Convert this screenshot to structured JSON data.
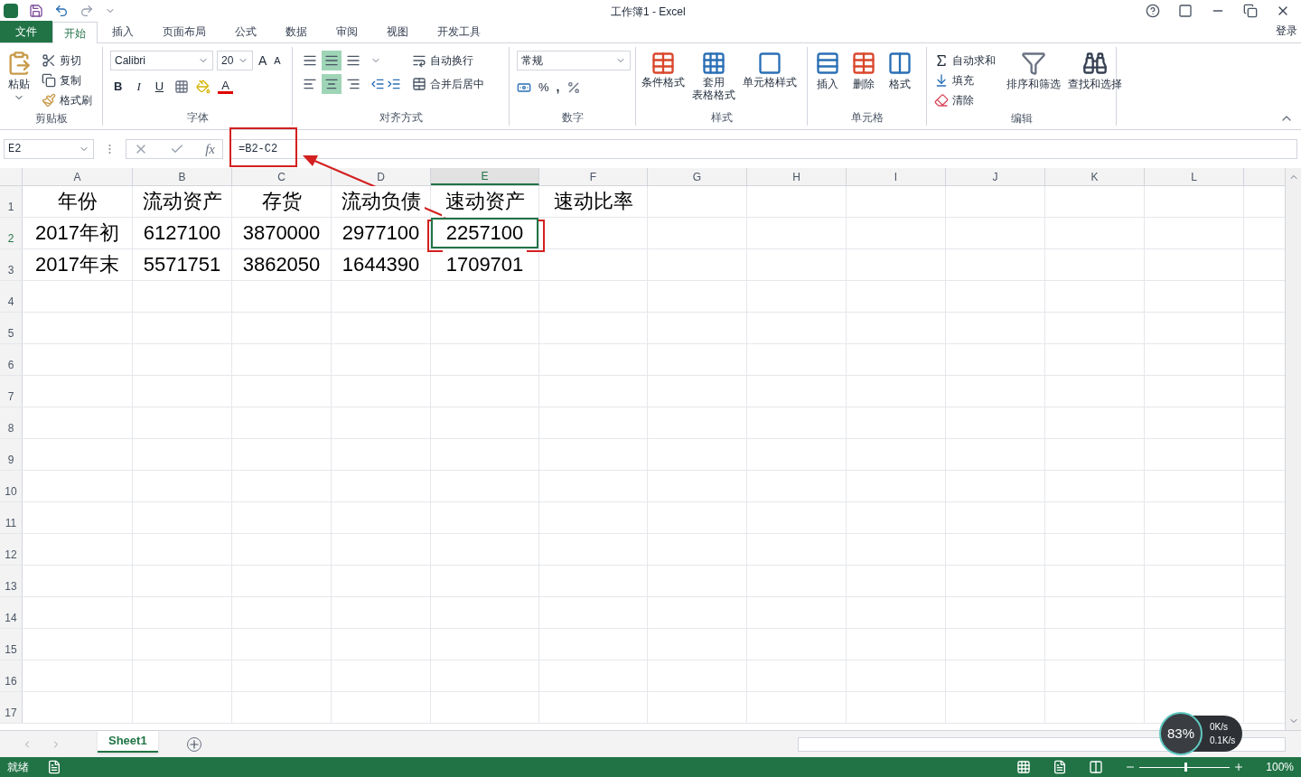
{
  "title_bar": {
    "title": "工作簿1 - Excel"
  },
  "ribbon_tabs": [
    {
      "label": "文件",
      "kind": "file",
      "selected": false
    },
    {
      "label": "开始",
      "kind": "tab",
      "selected": true
    },
    {
      "label": "插入",
      "kind": "tab",
      "selected": false
    },
    {
      "label": "页面布局",
      "kind": "tab",
      "selected": false
    },
    {
      "label": "公式",
      "kind": "tab",
      "selected": false
    },
    {
      "label": "数据",
      "kind": "tab",
      "selected": false
    },
    {
      "label": "审阅",
      "kind": "tab",
      "selected": false
    },
    {
      "label": "视图",
      "kind": "tab",
      "selected": false
    },
    {
      "label": "开发工具",
      "kind": "tab",
      "selected": false
    }
  ],
  "account": "登录",
  "clipboard": {
    "label": "剪贴板",
    "paste": "粘贴",
    "cut": "剪切",
    "copy": "复制",
    "format_painter": "格式刷"
  },
  "font": {
    "label": "字体",
    "font_name": "Calibri",
    "font_size": "20",
    "grow": "A",
    "shrink": "A",
    "bold": "B",
    "italic": "I",
    "underline": "U",
    "font_color": "A"
  },
  "alignment": {
    "label": "对齐方式",
    "vertical": [
      {
        "selected": false
      },
      {
        "selected": true
      },
      {
        "selected": false
      }
    ],
    "horizontal": [
      {
        "selected": false
      },
      {
        "selected": true
      },
      {
        "selected": false
      }
    ],
    "wrap": "自动换行",
    "merge": "合并后居中"
  },
  "number": {
    "label": "数字",
    "format": "常规",
    "percent": "%",
    "comma": ","
  },
  "styles": {
    "label": "样式",
    "buttons": [
      {
        "lines": [
          "条件格式"
        ],
        "kind": "conditional"
      },
      {
        "lines": [
          "套用",
          "表格格式"
        ],
        "kind": "table"
      },
      {
        "lines": [
          "单元格样式"
        ],
        "kind": "cellstyle"
      }
    ]
  },
  "cells_group": {
    "label": "单元格",
    "buttons": [
      {
        "label": "插入",
        "kind": "insert"
      },
      {
        "label": "删除",
        "kind": "delete"
      },
      {
        "label": "格式",
        "kind": "format"
      }
    ]
  },
  "editing": {
    "label": "编辑",
    "autosum": "自动求和",
    "fill": "填充",
    "clear": "清除",
    "sort": "排序和筛选",
    "find": "查找和选择"
  },
  "formula_bar": {
    "name_box": "E2",
    "function_label": "fx",
    "formula": "=B2-C2"
  },
  "columns": [
    {
      "label": "A",
      "selected": false
    },
    {
      "label": "B",
      "selected": false
    },
    {
      "label": "C",
      "selected": false
    },
    {
      "label": "D",
      "selected": false
    },
    {
      "label": "E",
      "selected": true
    },
    {
      "label": "F",
      "selected": false
    },
    {
      "label": "G",
      "selected": false
    },
    {
      "label": "H",
      "selected": false
    },
    {
      "label": "I",
      "selected": false
    },
    {
      "label": "J",
      "selected": false
    },
    {
      "label": "K",
      "selected": false
    },
    {
      "label": "L",
      "selected": false
    }
  ],
  "rows": [
    {
      "header": "1",
      "selected": false,
      "cells": [
        {
          "text": "年份",
          "selected": false
        },
        {
          "text": "流动资产",
          "selected": false
        },
        {
          "text": "存货",
          "selected": false
        },
        {
          "text": "流动负债",
          "selected": false
        },
        {
          "text": "速动资产",
          "selected": false
        },
        {
          "text": "速动比率",
          "selected": false
        }
      ]
    },
    {
      "header": "2",
      "selected": true,
      "cells": [
        {
          "text": "2017年初",
          "selected": false
        },
        {
          "text": "6127100",
          "selected": false
        },
        {
          "text": "3870000",
          "selected": false
        },
        {
          "text": "2977100",
          "selected": false
        },
        {
          "text": "2257100",
          "selected": true
        }
      ]
    },
    {
      "header": "3",
      "selected": false,
      "cells": [
        {
          "text": "2017年末",
          "selected": false
        },
        {
          "text": "5571751",
          "selected": false
        },
        {
          "text": "3862050",
          "selected": false
        },
        {
          "text": "1644390",
          "selected": false
        },
        {
          "text": "1709701",
          "selected": false
        }
      ]
    },
    {
      "header": "4",
      "selected": false
    },
    {
      "header": "5",
      "selected": false
    },
    {
      "header": "6",
      "selected": false
    },
    {
      "header": "7",
      "selected": false
    },
    {
      "header": "8",
      "selected": false
    },
    {
      "header": "9",
      "selected": false
    },
    {
      "header": "10",
      "selected": false
    },
    {
      "header": "11",
      "selected": false
    },
    {
      "header": "12",
      "selected": false
    },
    {
      "header": "13",
      "selected": false
    },
    {
      "header": "14",
      "selected": false
    },
    {
      "header": "15",
      "selected": false
    },
    {
      "header": "16",
      "selected": false
    },
    {
      "header": "17",
      "selected": false
    }
  ],
  "sheet_tabs": [
    {
      "label": "Sheet1",
      "selected": true
    }
  ],
  "status_bar": {
    "status": "就绪",
    "zoom": "100%",
    "zoom_slider": {
      "level": 0.5
    }
  },
  "speed_widget": {
    "percent": "83%",
    "upload": "0K/s",
    "download": "0.1K/s"
  }
}
